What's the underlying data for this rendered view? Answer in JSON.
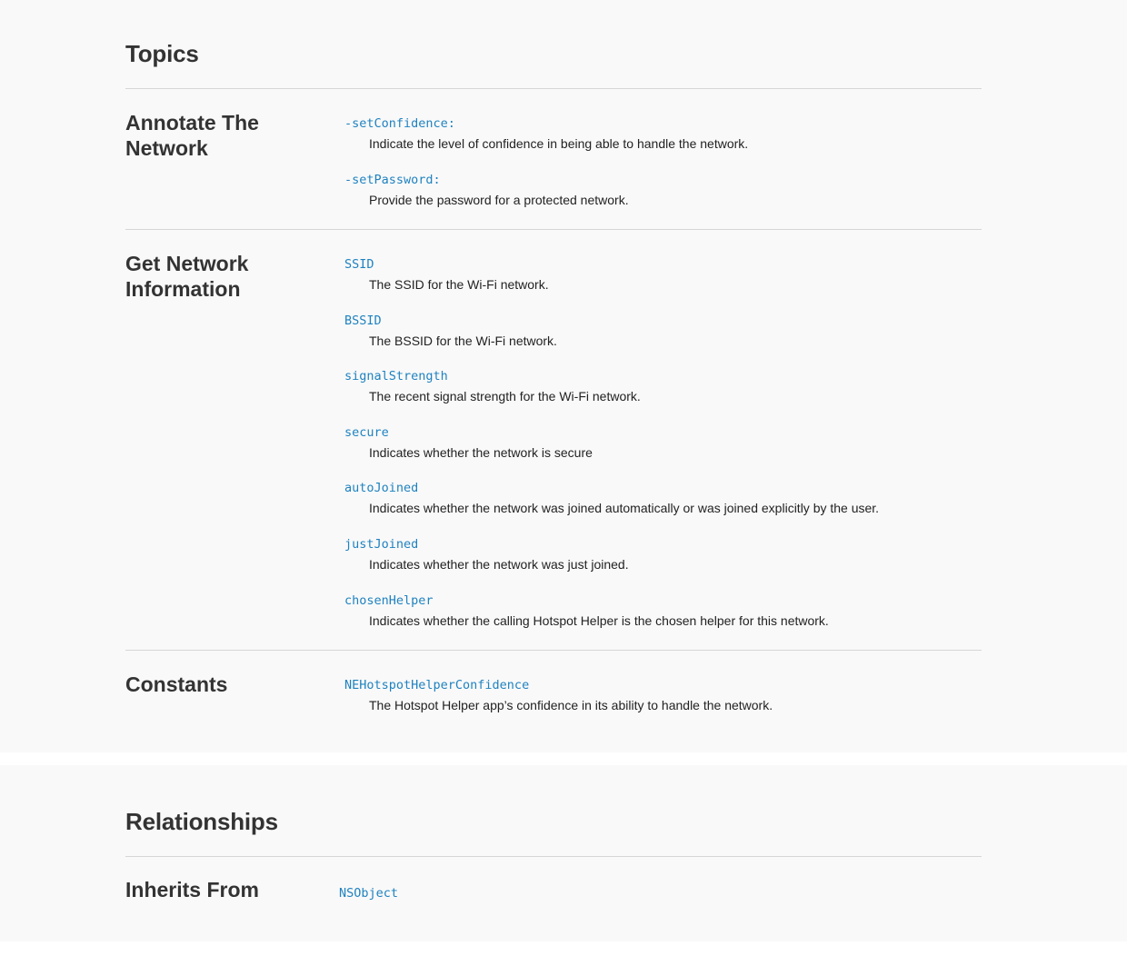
{
  "topics": {
    "title": "Topics",
    "groups": [
      {
        "title": "Annotate The Network",
        "items": [
          {
            "name": "-setConfidence:",
            "description": "Indicate the level of confidence in being able to handle the network."
          },
          {
            "name": "-setPassword:",
            "description": "Provide the password for a protected network."
          }
        ]
      },
      {
        "title": "Get Network Information",
        "items": [
          {
            "name": "SSID",
            "description": "The SSID for the Wi-Fi network."
          },
          {
            "name": "BSSID",
            "description": "The BSSID for the Wi-Fi network."
          },
          {
            "name": "signalStrength",
            "description": "The recent signal strength for the Wi-Fi network."
          },
          {
            "name": "secure",
            "description": "Indicates whether the network is secure"
          },
          {
            "name": "autoJoined",
            "description": "Indicates whether the network was joined automatically or was joined explicitly by the user."
          },
          {
            "name": "justJoined",
            "description": "Indicates whether the network was just joined."
          },
          {
            "name": "chosenHelper",
            "description": "Indicates whether the calling Hotspot Helper is the chosen helper for this network."
          }
        ]
      },
      {
        "title": "Constants",
        "items": [
          {
            "name": "NEHotspotHelperConfidence",
            "description": "The Hotspot Helper app’s confidence in its ability to handle the network."
          }
        ]
      }
    ]
  },
  "relationships": {
    "title": "Relationships",
    "inherits_from": {
      "title": "Inherits From",
      "link": "NSObject"
    }
  }
}
